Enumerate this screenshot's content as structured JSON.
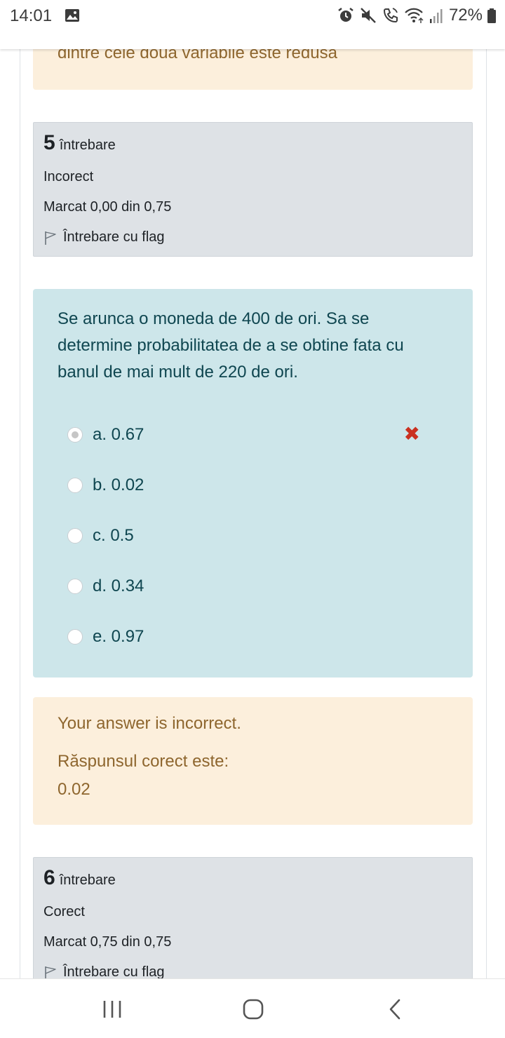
{
  "status_bar": {
    "time": "14:01",
    "battery": "72%"
  },
  "previous_feedback": {
    "clipped_text": "dintre cele două variabile este redusă"
  },
  "question5_info": {
    "number": "5",
    "label": "întrebare",
    "state": "Incorect",
    "mark": "Marcat 0,00 din 0,75",
    "flag": "Întrebare cu flag"
  },
  "question5": {
    "text": "Se arunca o moneda de 400 de ori. Sa se determine probabilitatea de a se obtine fata cu banul de mai mult de 220 de ori.",
    "answers": [
      {
        "label": "a. 0.67",
        "selected": true,
        "incorrect": true
      },
      {
        "label": "b. 0.02",
        "selected": false
      },
      {
        "label": "c. 0.5",
        "selected": false
      },
      {
        "label": "d. 0.34",
        "selected": false
      },
      {
        "label": "e. 0.97",
        "selected": false
      }
    ],
    "wrong_mark": "✖"
  },
  "question5_feedback": {
    "result": "Your answer is incorrect.",
    "correct_label": "Răspunsul corect este:",
    "correct_value": "0.02"
  },
  "question6_info": {
    "number": "6",
    "label": "întrebare",
    "state": "Corect",
    "mark": "Marcat 0,75 din 0,75",
    "flag": "Întrebare cu flag"
  },
  "icons": {
    "status": [
      "image-icon",
      "alarm-icon",
      "mute-icon",
      "vibrate-call-icon",
      "wifi-icon",
      "signal-icon",
      "battery-icon"
    ],
    "nav": [
      "recent-apps-icon",
      "home-icon",
      "back-icon"
    ]
  },
  "colors": {
    "question_bg": "#cde6ea",
    "feedback_bg": "#fcefdc",
    "info_bg": "#dee2e6",
    "incorrect": "#ca3120"
  }
}
